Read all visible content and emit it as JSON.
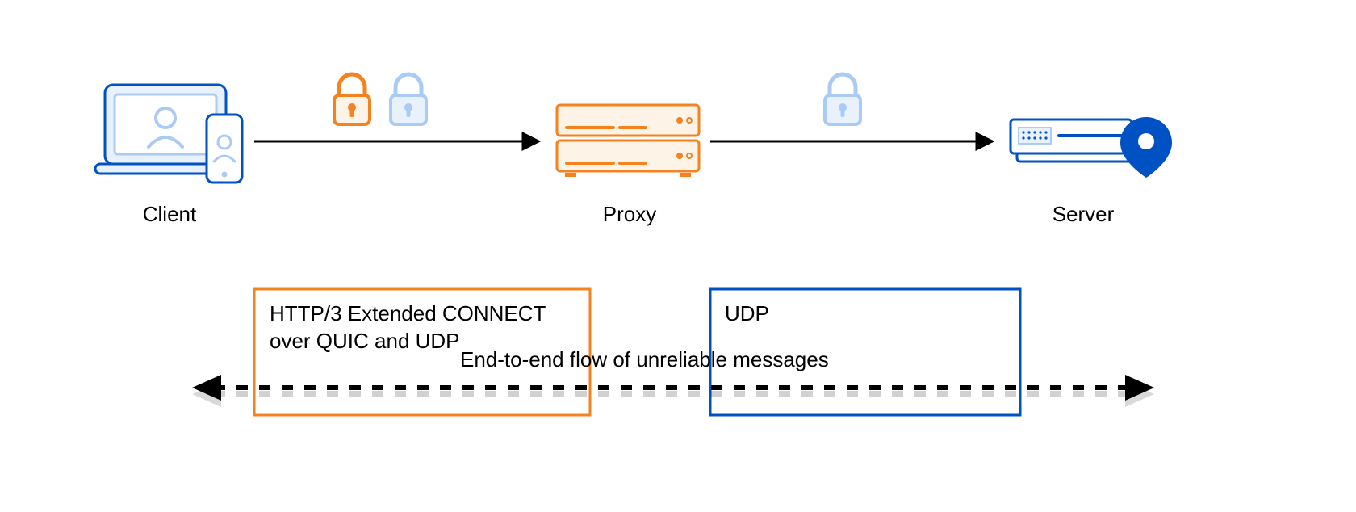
{
  "nodes": {
    "client": {
      "label": "Client"
    },
    "proxy": {
      "label": "Proxy"
    },
    "server": {
      "label": "Server"
    }
  },
  "locks": {
    "client_proxy_outer": {
      "color": "orange",
      "meaning": "TLS to proxy (outer)"
    },
    "client_proxy_inner": {
      "color": "blue",
      "meaning": "TLS end-to-end (inner)"
    },
    "proxy_server": {
      "color": "blue",
      "meaning": "TLS end-to-end (inner)"
    }
  },
  "protocol_boxes": {
    "left": {
      "label": "HTTP/3 Extended CONNECT\nover QUIC and UDP",
      "color": "#f6821f"
    },
    "right": {
      "label": "UDP",
      "color": "#0051c3"
    }
  },
  "flow_caption": "End-to-end flow of unreliable messages",
  "colors": {
    "orange": "#f6821f",
    "orange_fill": "#fef3e7",
    "blue": "#0051c3",
    "blue_light": "#a9cbf5",
    "blue_fill": "#e9f1fc"
  }
}
